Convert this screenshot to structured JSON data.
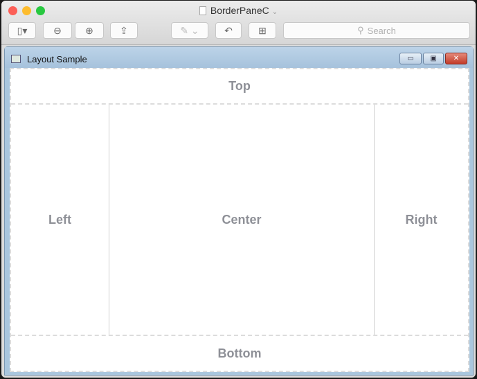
{
  "mac_window": {
    "title": "BorderPaneC",
    "search_placeholder": "Search",
    "toolbar": [
      "sidebar-toggle",
      "zoom-out",
      "zoom-in",
      "share",
      "markup",
      "rotate",
      "toolbox"
    ]
  },
  "app_window": {
    "title": "Layout Sample",
    "controls": [
      "minimize",
      "maximize",
      "close"
    ]
  },
  "regions": {
    "top": "Top",
    "left": "Left",
    "center": "Center",
    "right": "Right",
    "bottom": "Bottom"
  }
}
